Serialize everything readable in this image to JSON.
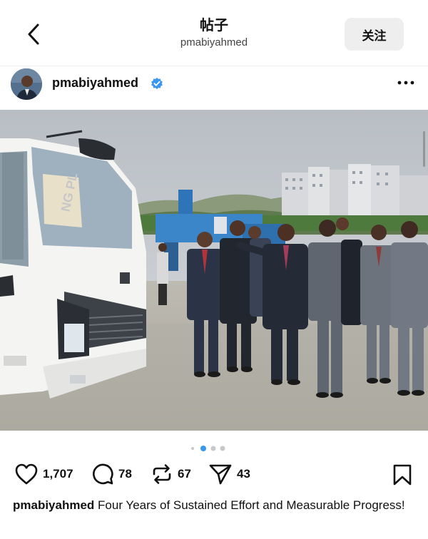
{
  "header": {
    "title": "帖子",
    "subtitle": "pmabiyahmed",
    "follow_label": "关注"
  },
  "post": {
    "author": "pmabiyahmed",
    "verified": true,
    "carousel": {
      "count": 4,
      "active_index": 1
    },
    "photo_text": {
      "truck_sign": "NG PL"
    },
    "stats": {
      "likes": "1,707",
      "comments": "78",
      "reposts": "67",
      "shares": "43"
    },
    "caption_user": "pmabiyahmed",
    "caption_text": "Four Years of Sustained Effort and Measurable Progress!"
  },
  "icons": {
    "back": "chevron-left-icon",
    "verified": "verified-badge-icon",
    "more": "more-dots-icon",
    "like": "heart-icon",
    "comment": "comment-icon",
    "repost": "repost-icon",
    "share": "send-icon",
    "save": "bookmark-icon"
  },
  "colors": {
    "verified_blue": "#3897f0",
    "dot_active": "#3897f0",
    "dot_inactive": "#c8c8c8",
    "follow_bg": "#eeeeef"
  }
}
